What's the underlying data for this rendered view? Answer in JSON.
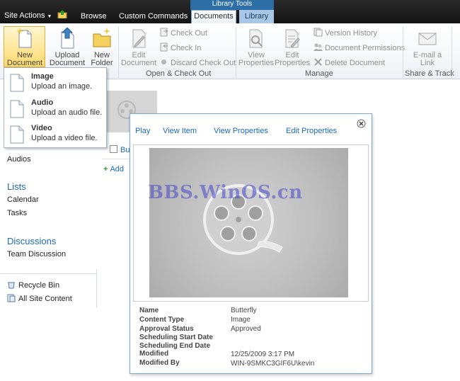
{
  "topbar": {
    "site_actions": "Site Actions",
    "tabs": [
      "Browse",
      "Custom Commands",
      "Documents",
      "Library"
    ],
    "context_group": "Library Tools"
  },
  "ribbon": {
    "new_document": "New Document",
    "new_document_line1": "New",
    "new_document_line2": "Document",
    "upload_line1": "Upload",
    "upload_line2": "Document",
    "new_folder_line1": "New",
    "new_folder_line2": "Folder",
    "edit_doc_line1": "Edit",
    "edit_doc_line2": "Document",
    "check_out": "Check Out",
    "check_in": "Check In",
    "discard_check_out": "Discard Check Out",
    "group_open_check": "Open & Check Out",
    "view_props_line1": "View",
    "view_props_line2": "Properties",
    "edit_props_line1": "Edit",
    "edit_props_line2": "Properties",
    "version_history": "Version History",
    "document_permissions": "Document Permissions",
    "delete_document": "Delete Document",
    "group_manage": "Manage",
    "email_line1": "E-mail a",
    "email_line2": "Link",
    "group_share": "Share & Track"
  },
  "dropdown": [
    {
      "title": "Image",
      "desc": "Upload an image."
    },
    {
      "title": "Audio",
      "desc": "Upload an audio file."
    },
    {
      "title": "Video",
      "desc": "Upload a video file."
    }
  ],
  "leftnav": {
    "audios": "Audios",
    "lists_head": "Lists",
    "calendar": "Calendar",
    "tasks": "Tasks",
    "discussions_head": "Discussions",
    "team_discussion": "Team Discussion",
    "recycle_bin": "Recycle Bin",
    "all_site_content": "All Site Content"
  },
  "background": {
    "item_label": "Bu",
    "add_label": "Add"
  },
  "callout": {
    "links": [
      "Play",
      "View Item",
      "View Properties",
      "Edit Properties"
    ],
    "watermark": "BBS.WinOS.cn",
    "fields": [
      {
        "label": "Name",
        "value": "Butterfly"
      },
      {
        "label": "Content Type",
        "value": "Image"
      },
      {
        "label": "Approval Status",
        "value": "Approved"
      },
      {
        "label": "Scheduling Start Date",
        "value": ""
      },
      {
        "label": "Scheduling End Date",
        "value": ""
      },
      {
        "label": "Modified",
        "value": "12/25/2009 3:17 PM"
      },
      {
        "label": "Modified By",
        "value": "WIN-9SMKC3GIF6U\\kevin"
      }
    ]
  },
  "icons": {
    "site_actions_caret": "chevron-down-icon",
    "nav_up": "navigate-up-icon",
    "close": "close-icon"
  },
  "colors": {
    "accent": "#1b6ab3",
    "context_tab": "#2e6ea6",
    "topbar": "#1d1d1d"
  }
}
